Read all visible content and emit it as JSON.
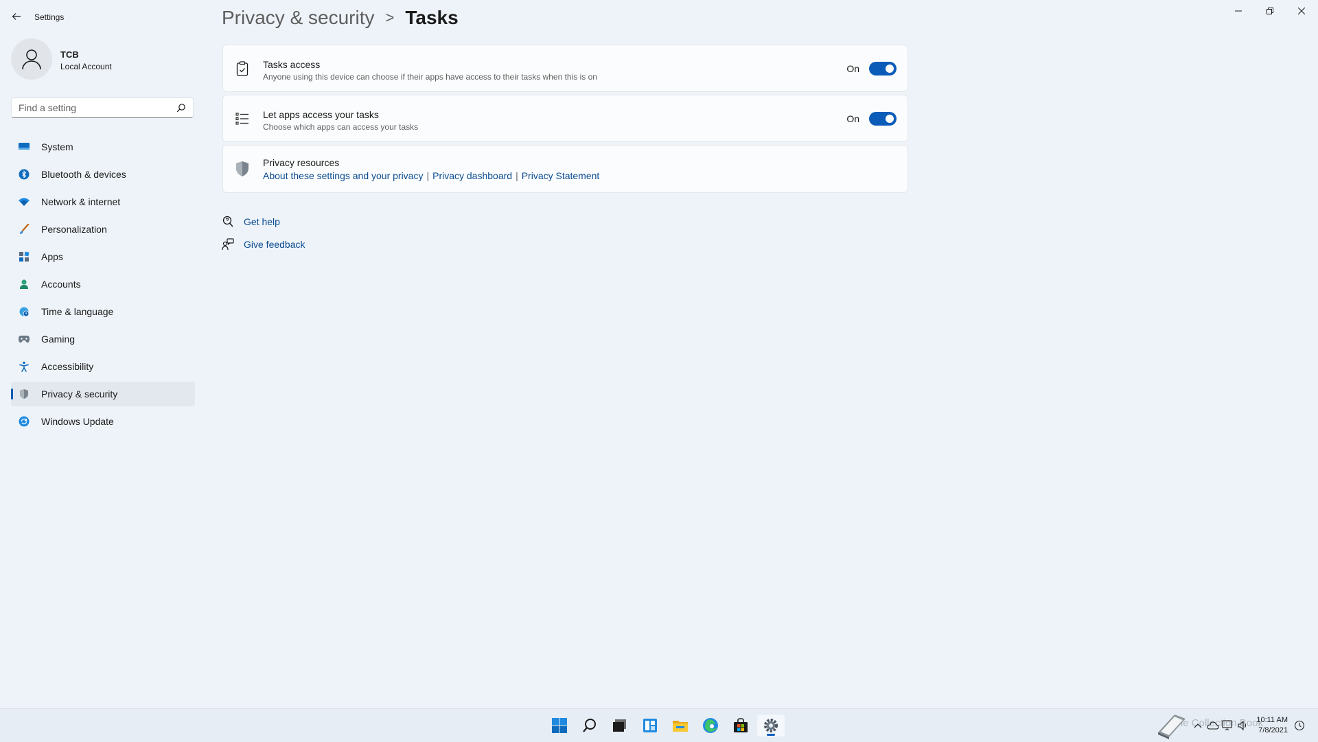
{
  "app": {
    "title": "Settings"
  },
  "profile": {
    "name": "TCB",
    "account_type": "Local Account"
  },
  "search": {
    "placeholder": "Find a setting"
  },
  "sidebar": {
    "items": [
      {
        "label": "System",
        "icon": "monitor-icon"
      },
      {
        "label": "Bluetooth & devices",
        "icon": "bluetooth-icon"
      },
      {
        "label": "Network & internet",
        "icon": "wifi-icon"
      },
      {
        "label": "Personalization",
        "icon": "brush-icon"
      },
      {
        "label": "Apps",
        "icon": "apps-icon"
      },
      {
        "label": "Accounts",
        "icon": "person-icon"
      },
      {
        "label": "Time & language",
        "icon": "globe-clock-icon"
      },
      {
        "label": "Gaming",
        "icon": "gamepad-icon"
      },
      {
        "label": "Accessibility",
        "icon": "accessibility-icon"
      },
      {
        "label": "Privacy & security",
        "icon": "shield-icon",
        "active": true
      },
      {
        "label": "Windows Update",
        "icon": "update-icon"
      }
    ]
  },
  "header": {
    "parent": "Privacy & security",
    "separator": ">",
    "current": "Tasks"
  },
  "cards": {
    "tasks_access": {
      "title": "Tasks access",
      "description": "Anyone using this device can choose if their apps have access to their tasks when this is on",
      "state_label": "On",
      "enabled": true
    },
    "apps_access": {
      "title": "Let apps access your tasks",
      "description": "Choose which apps can access your tasks",
      "state_label": "On",
      "enabled": true
    },
    "privacy_resources": {
      "title": "Privacy resources",
      "links": [
        "About these settings and your privacy",
        "Privacy dashboard",
        "Privacy Statement"
      ],
      "separator": "|"
    }
  },
  "help": {
    "get_help": "Get help",
    "give_feedback": "Give feedback"
  },
  "taskbar": {
    "apps": [
      "start-icon",
      "search-icon",
      "task-view-icon",
      "widgets-icon",
      "file-explorer-icon",
      "edge-icon",
      "store-icon",
      "settings-icon"
    ],
    "time": "10:11 AM",
    "date": "7/8/2021",
    "watermark": "The Collection Book"
  },
  "colors": {
    "accent": "#0a5cb8",
    "link": "#0a4b91",
    "background": "#eef3f9"
  }
}
